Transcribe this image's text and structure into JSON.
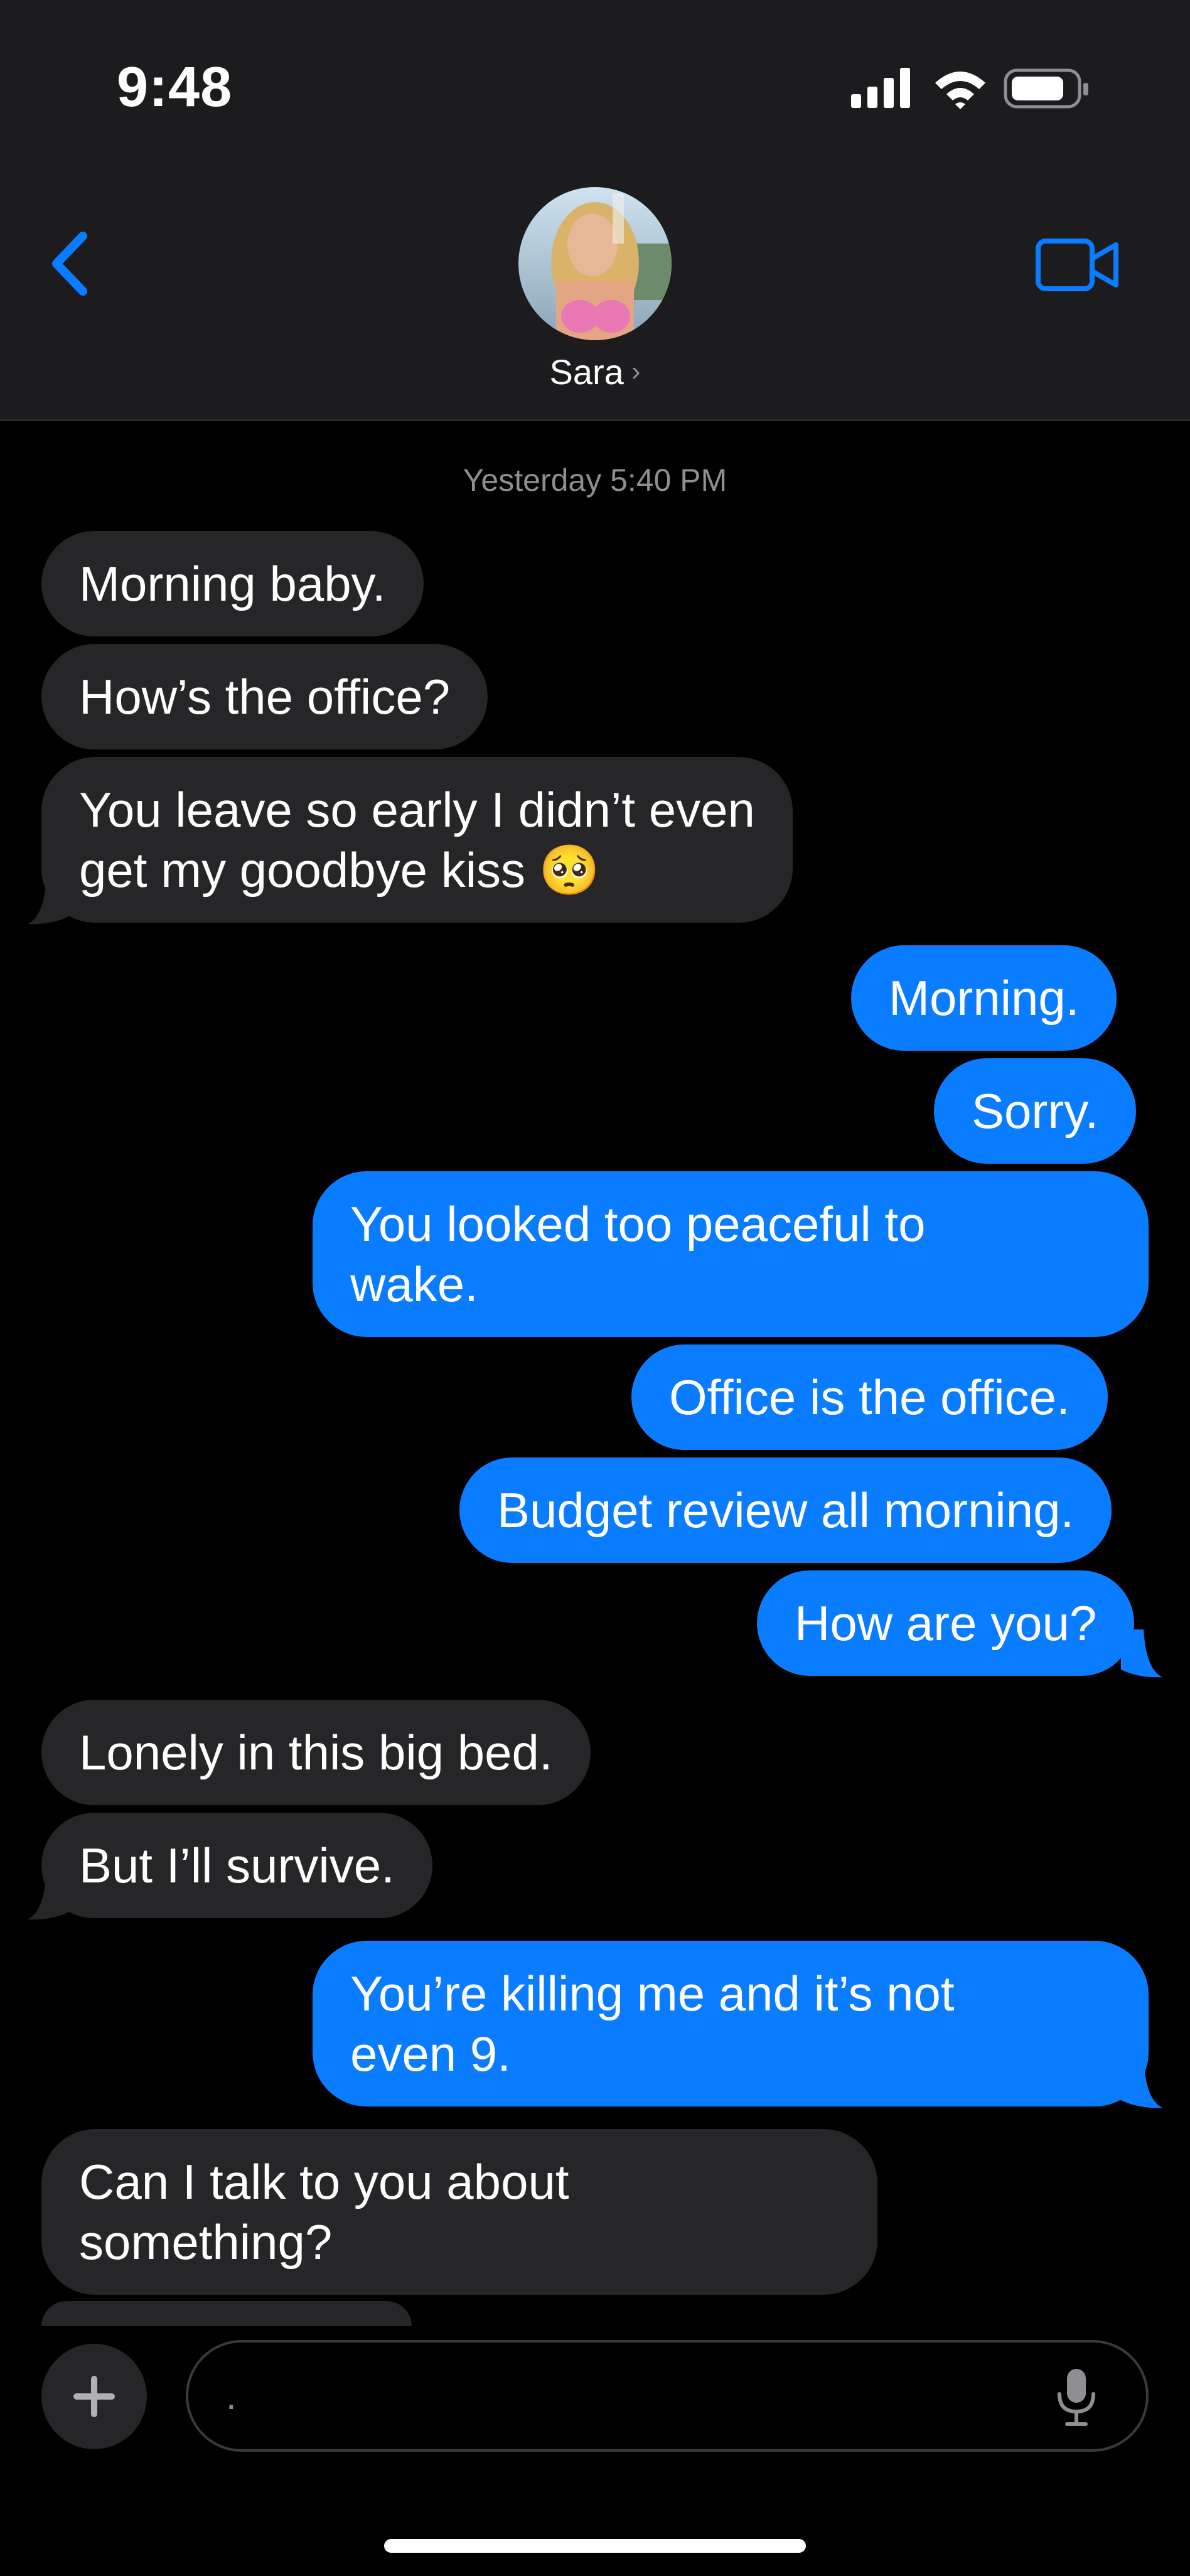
{
  "status_bar": {
    "time": "9:48",
    "icons": [
      "cellular-signal-icon",
      "wifi-icon",
      "battery-icon"
    ]
  },
  "header": {
    "back_icon": "chevron-left-icon",
    "contact_name": "Sara",
    "video_icon": "video-camera-icon",
    "accent_color": "#0a7cff",
    "header_bg": "#1c1c1e"
  },
  "conversation": {
    "timestamp": "Yesterday 5:40 PM",
    "messages": [
      {
        "sender": "Sara",
        "text": "Morning baby."
      },
      {
        "sender": "Sara",
        "text": "How’s the office?"
      },
      {
        "sender": "Sara",
        "text": "You leave so early I didn’t even\nget my goodbye kiss",
        "emoji": "🥺"
      },
      {
        "sender": "me",
        "text": "Morning."
      },
      {
        "sender": "me",
        "text": "Sorry."
      },
      {
        "sender": "me",
        "text": "You looked too peaceful to\nwake."
      },
      {
        "sender": "me",
        "text": "Office is the office."
      },
      {
        "sender": "me",
        "text": "Budget review all morning."
      },
      {
        "sender": "me",
        "text": "How are you?"
      },
      {
        "sender": "Sara",
        "text": "Lonely in this big bed."
      },
      {
        "sender": "Sara",
        "text": "But I’ll survive."
      },
      {
        "sender": "me",
        "text": "You’re killing me and it’s not\neven 9."
      },
      {
        "sender": "Sara",
        "text": "Can I talk to you about\nsomething?"
      }
    ],
    "incoming_color": "#262628",
    "outgoing_color": "#0a7cff"
  },
  "composer": {
    "plus_icon": "plus-icon",
    "input_value": ".",
    "mic_icon": "microphone-icon"
  }
}
